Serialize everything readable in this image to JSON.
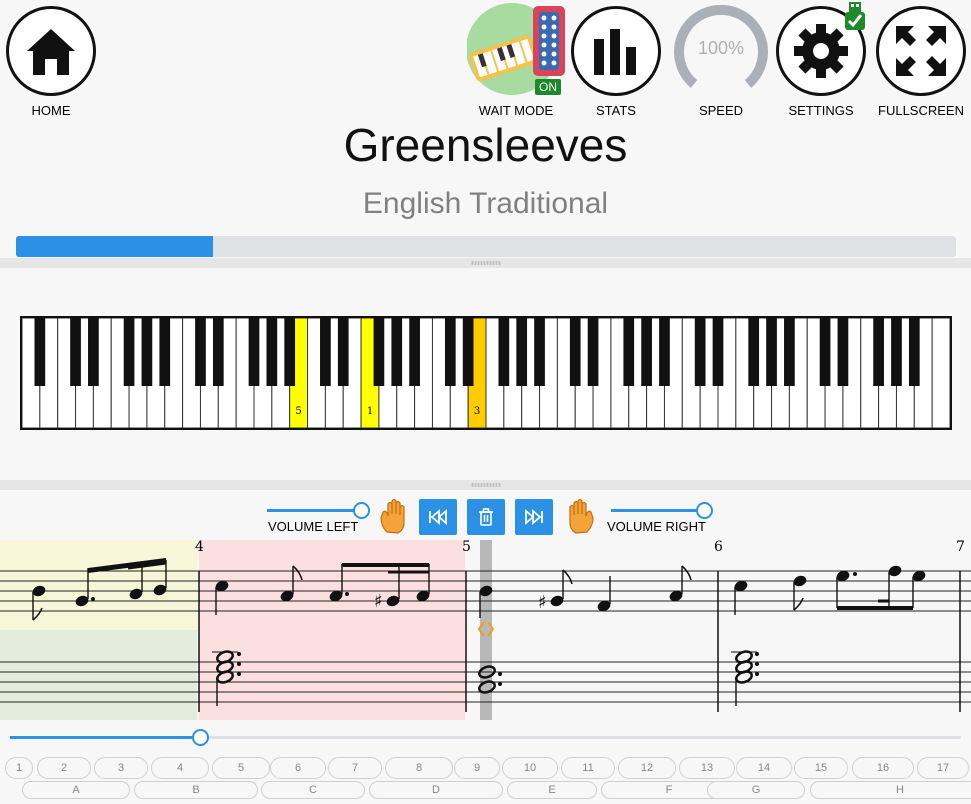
{
  "toolbar": {
    "home": "HOME",
    "wait_mode": "WAIT MODE",
    "wait_mode_status": "ON",
    "stats": "STATS",
    "speed": "SPEED",
    "speed_value": "100%",
    "settings": "SETTINGS",
    "fullscreen": "FULLSCREEN"
  },
  "song": {
    "title": "Greensleeves",
    "composer": "English Traditional",
    "progress": 0.21
  },
  "piano": {
    "highlighted_keys": [
      {
        "finger": "5",
        "color": "#ffff00"
      },
      {
        "finger": "1",
        "color": "#ffff00"
      },
      {
        "finger": "3",
        "color": "#ffcc00"
      }
    ]
  },
  "controls": {
    "volume_left_label": "VOLUME LEFT",
    "volume_right_label": "VOLUME RIGHT",
    "volume_left": 1.0,
    "volume_right": 1.0,
    "rewind_icon": "rewind-icon",
    "clear_icon": "trash-icon",
    "forward_icon": "fast-forward-icon",
    "left_hand_icon": "hand-left-icon",
    "right_hand_icon": "hand-right-icon"
  },
  "score": {
    "measure_numbers": [
      "4",
      "5",
      "6",
      "7"
    ]
  },
  "seek": {
    "position": 0.2
  },
  "measures": [
    "1",
    "2",
    "3",
    "4",
    "5",
    "6",
    "7",
    "8",
    "9",
    "10",
    "11",
    "12",
    "13",
    "14",
    "15",
    "16",
    "17"
  ],
  "sections": [
    "A",
    "B",
    "C",
    "D",
    "E",
    "F",
    "G",
    "H"
  ]
}
